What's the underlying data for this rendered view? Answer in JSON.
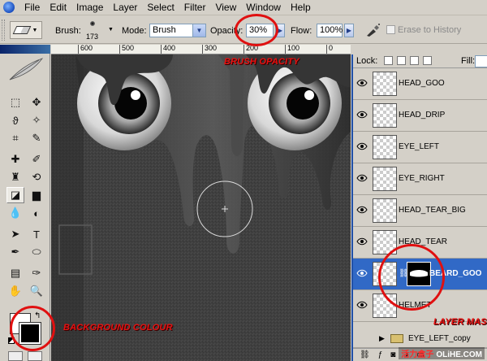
{
  "menu": {
    "items": [
      "File",
      "Edit",
      "Image",
      "Layer",
      "Select",
      "Filter",
      "View",
      "Window",
      "Help"
    ]
  },
  "options": {
    "brush_label": "Brush:",
    "brush_size": "173",
    "mode_label": "Mode:",
    "mode_value": "Brush",
    "opacity_label": "Opacity:",
    "opacity_value": "30%",
    "flow_label": "Flow:",
    "flow_value": "100%",
    "erase_history_label": "Erase to History"
  },
  "ruler": {
    "ticks": [
      "700",
      "600",
      "500",
      "400",
      "300",
      "200",
      "100",
      "0"
    ]
  },
  "toolbox": {
    "icons": [
      "marquee-icon",
      "move-icon",
      "lasso-icon",
      "magic-wand-icon",
      "crop-icon",
      "slice-icon",
      "healing-brush-icon",
      "brush-icon",
      "clone-stamp-icon",
      "history-brush-icon",
      "eraser-icon",
      "gradient-icon",
      "blur-icon",
      "dodge-icon",
      "path-selection-icon",
      "type-icon",
      "pen-icon",
      "shape-icon",
      "notes-icon",
      "eyedropper-icon",
      "hand-icon",
      "zoom-icon"
    ]
  },
  "layers": {
    "lock_label": "Lock:",
    "fill_label": "Fill:",
    "ruler_ticks": [
      "400",
      "200",
      "100"
    ],
    "rows": [
      {
        "name": "HEAD_GOO",
        "selected": false
      },
      {
        "name": "HEAD_DRIP",
        "selected": false
      },
      {
        "name": "EYE_LEFT",
        "selected": false
      },
      {
        "name": "EYE_RIGHT",
        "selected": false
      },
      {
        "name": "HEAD_TEAR_BIG",
        "selected": false
      },
      {
        "name": "HEAD_TEAR",
        "selected": false
      },
      {
        "name": "BEARD_GOO",
        "selected": true
      },
      {
        "name": "HELMET",
        "selected": false
      }
    ],
    "group_name": "EYE_LEFT_copy"
  },
  "annotations": {
    "brush_opacity": "BRUSH OPACITY",
    "background_colour": "BACKGROUND COLOUR",
    "layer_mask": "LAYER MASK"
  },
  "watermark": {
    "cn": "活力盒子",
    "en": "OLiHE.COM"
  },
  "colors": {
    "annotation_red": "#e01010",
    "selection_blue": "#3169c6",
    "title_blue": "#0a246a"
  }
}
